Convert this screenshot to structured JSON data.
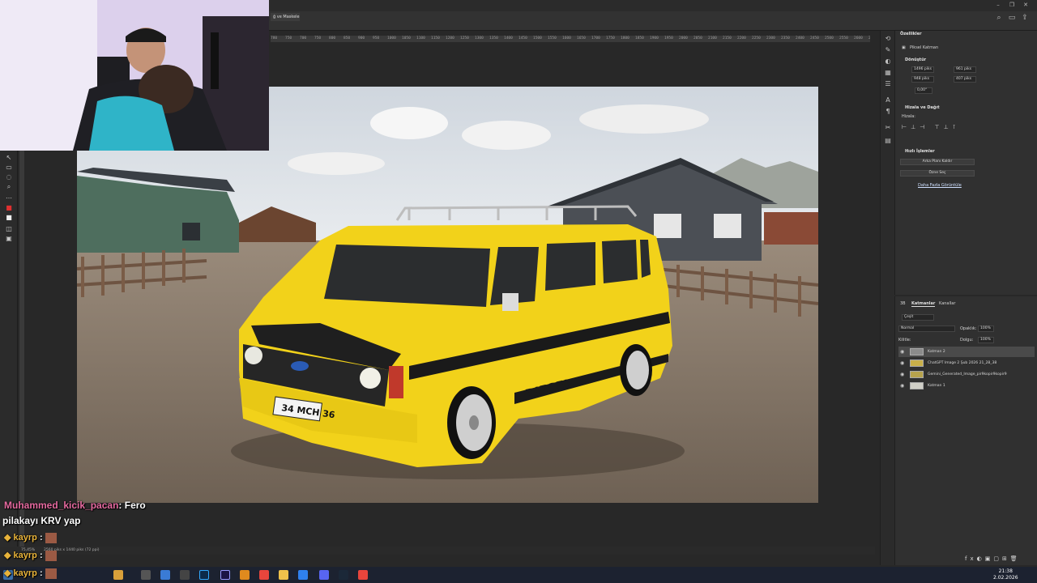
{
  "document_tab": "ğ ve Maskele...",
  "ruler_ticks": [
    "780",
    "750",
    "700",
    "750",
    "800",
    "850",
    "900",
    "950",
    "1000",
    "1050",
    "1100",
    "1150",
    "1200",
    "1250",
    "1300",
    "1350",
    "1400",
    "1450",
    "1500",
    "1550",
    "1600",
    "1650",
    "1700",
    "1750",
    "1800",
    "1850",
    "1900",
    "1950",
    "2000",
    "2050",
    "2100",
    "2150",
    "2200",
    "2250",
    "2300",
    "2350",
    "2400",
    "2450",
    "2500",
    "2550",
    "2600",
    "2650"
  ],
  "properties": {
    "tab": "Özellikler",
    "layer_type": "Piksel Katman",
    "transform_header": "Dönüştür",
    "w": "1496 piks",
    "x": "961 piks",
    "h": "948 piks",
    "y": "407 piks",
    "angle": "0,00°",
    "align_header": "Hizala ve Dağıt",
    "align_label": "Hizala:",
    "quick_actions_header": "Hızlı İşlemler",
    "remove_bg_button": "Arka Planı Kaldır",
    "select_subject_button": "Özne Seç",
    "more_link": "Daha Fazla Görüntüle"
  },
  "layers_panel": {
    "tab_3d": "3B",
    "tab_layers": "Katmanlar",
    "tab_channels": "Kanallar",
    "filter_kind": "Çeşit",
    "blend_mode": "Normal",
    "opacity_label": "Opaklık:",
    "opacity_value": "100%",
    "lock_label": "Kilitle:",
    "fill_label": "Dolgu:",
    "fill_value": "100%",
    "layers": [
      {
        "name": "Katman 2"
      },
      {
        "name": "ChatGPT Image 2 Şub 2026 21_28_38"
      },
      {
        "name": "Gemini_Generated_Image_pir9kopir9kopir9"
      },
      {
        "name": "Katman 1"
      }
    ]
  },
  "status_bar": {
    "zoom": "75,45%",
    "doc_info": "2560 piks x 1440 piks (72 ppi)"
  },
  "canvas_image": {
    "plate_text": "34 MCH 36",
    "badge_text": "DIESEL",
    "van_color": "#f2d21a"
  },
  "chat": [
    {
      "user": "Muhammed_kicik_pacan",
      "sep": ": ",
      "message": "Fero"
    },
    {
      "user": "",
      "sep": "",
      "message": "pilakayı KRV yap"
    },
    {
      "user": "kayrp",
      "sep": " :",
      "message": ""
    },
    {
      "user": "kayrp",
      "sep": " :",
      "message": ""
    },
    {
      "user": "kayrp",
      "sep": " :",
      "message": ""
    }
  ],
  "taskbar": {
    "time": "21:38",
    "date": "2.02.2026"
  },
  "colors": {
    "accent": "#2d8ceb",
    "panel": "#303030",
    "taskbar": "#1c2230"
  }
}
